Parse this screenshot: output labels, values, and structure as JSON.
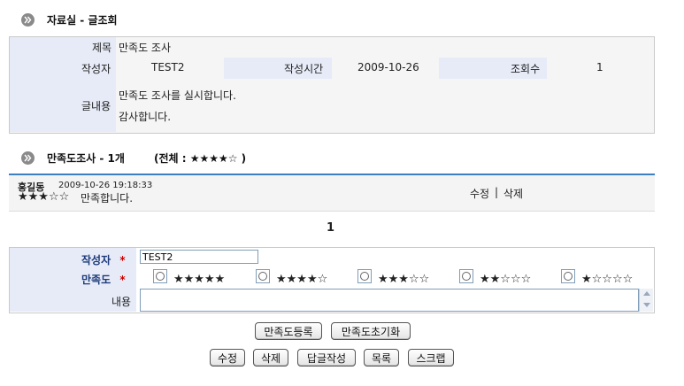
{
  "view": {
    "section_title": "자료실 - 글조회",
    "subject_label": "제목",
    "subject_value": "만족도 조사",
    "author_label": "작성자",
    "author_value": "TEST2",
    "date_label": "작성시간",
    "date_value": "2009-10-26",
    "views_label": "조회수",
    "views_value": "1",
    "content_label": "글내용",
    "content_line1": "만족도 조사를 실시합니다.",
    "content_line2": "감사합니다."
  },
  "survey": {
    "section_title": "만족도조사 - 1개",
    "total_text": "(전체 : ★★★★☆ )",
    "entries": [
      {
        "name": "홍길동",
        "datetime": "2009-10-26 19:18:33",
        "stars": "★★★☆☆",
        "comment": "만족합니다.",
        "edit_label": "수정",
        "separator": "|",
        "delete_label": "삭제"
      }
    ],
    "page_number": "1"
  },
  "form": {
    "author_label": "작성자",
    "required_mark": "*",
    "author_value": "TEST2",
    "rating_label": "만족도",
    "rating_options": [
      "★★★★★",
      "★★★★☆",
      "★★★☆☆",
      "★★☆☆☆",
      "★☆☆☆☆"
    ],
    "content_label": "내용",
    "content_value": ""
  },
  "buttons": {
    "register": "만족도등록",
    "reset": "만족도초기화",
    "edit": "수정",
    "delete": "삭제",
    "reply": "답글작성",
    "list": "목록",
    "scrap": "스크랩"
  },
  "colors": {
    "label_bg": "#e6ebf7",
    "panel_bg": "#f5f5f5",
    "accent_line": "#3d7fc1",
    "required": "#cc0000",
    "form_label": "#1d3a7a"
  }
}
